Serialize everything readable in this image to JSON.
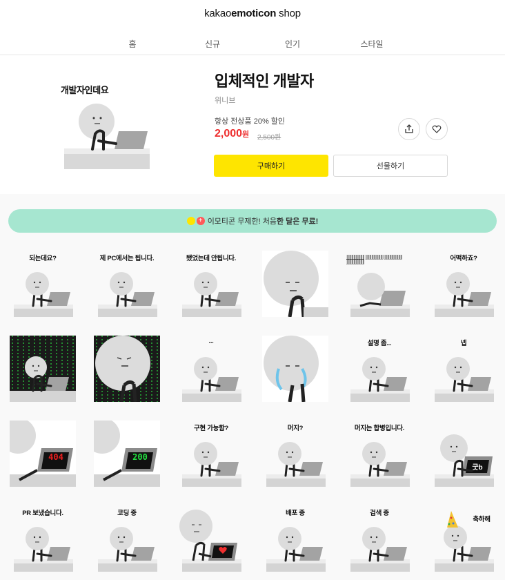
{
  "header": {
    "logo_prefix": "kakao",
    "logo_bold": "emoticon",
    "logo_suffix": " shop"
  },
  "nav": {
    "items": [
      "홈",
      "신규",
      "인기",
      "스타일"
    ]
  },
  "product": {
    "hero_caption": "개발자인데요",
    "title": "입체적인 개발자",
    "artist": "위니브",
    "promo": "항상 전상품 20% 할인",
    "price": "2,000",
    "price_unit": "원",
    "original_price": "2,500원",
    "buy_label": "구매하기",
    "gift_label": "선물하기",
    "share_icon": "share-icon",
    "like_icon": "heart-icon"
  },
  "banner": {
    "text_a": "이모티콘 무제한! 처음 ",
    "text_b": "한 달은 무료!"
  },
  "emoticons": [
    {
      "caption": "되는데요?",
      "kind": "desk"
    },
    {
      "caption": "제 PC에서는 됩니다.",
      "kind": "desk"
    },
    {
      "caption": "됐었는데 안됩니다.",
      "kind": "desk"
    },
    {
      "caption": "",
      "kind": "closeup"
    },
    {
      "caption": "]]]]]]]]]]]]]]]]]]",
      "kind": "back"
    },
    {
      "caption": "어떡하죠?",
      "kind": "desk"
    },
    {
      "caption": "",
      "kind": "matrix"
    },
    {
      "caption": "",
      "kind": "matrix-closeup"
    },
    {
      "caption": "...",
      "kind": "desk"
    },
    {
      "caption": "",
      "kind": "crying"
    },
    {
      "caption": "설명 좀...",
      "kind": "desk"
    },
    {
      "caption": "넵",
      "kind": "desk"
    },
    {
      "caption": "404",
      "kind": "monitor-red"
    },
    {
      "caption": "200",
      "kind": "monitor-green"
    },
    {
      "caption": "구현 가능함?",
      "kind": "desk"
    },
    {
      "caption": "머지?",
      "kind": "desk"
    },
    {
      "caption": "머지는 합병입니다.",
      "kind": "desk"
    },
    {
      "caption": "굿b",
      "kind": "monitor-text"
    },
    {
      "caption": "PR 보냈습니다.",
      "kind": "desk"
    },
    {
      "caption": "코딩 중",
      "kind": "desk"
    },
    {
      "caption": "",
      "kind": "heart-monitor"
    },
    {
      "caption": "배포 중",
      "kind": "desk"
    },
    {
      "caption": "검색 중",
      "kind": "desk"
    },
    {
      "caption": "축하해",
      "kind": "party"
    }
  ]
}
